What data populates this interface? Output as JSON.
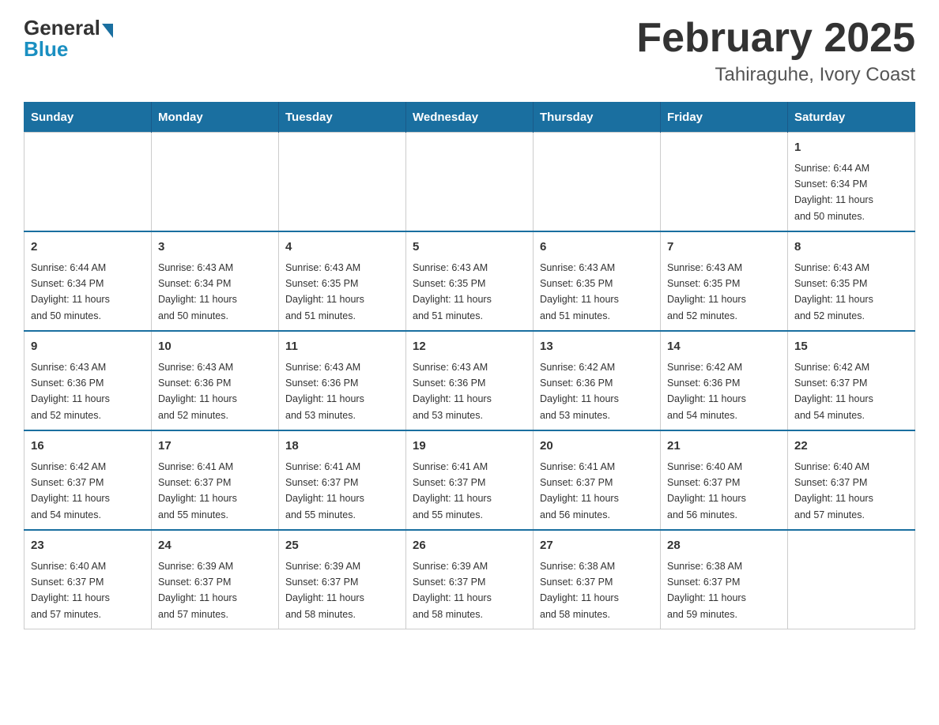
{
  "header": {
    "logo_general": "General",
    "logo_blue": "Blue",
    "title": "February 2025",
    "subtitle": "Tahiraguhe, Ivory Coast"
  },
  "days_of_week": [
    "Sunday",
    "Monday",
    "Tuesday",
    "Wednesday",
    "Thursday",
    "Friday",
    "Saturday"
  ],
  "weeks": [
    [
      {
        "day": "",
        "info": ""
      },
      {
        "day": "",
        "info": ""
      },
      {
        "day": "",
        "info": ""
      },
      {
        "day": "",
        "info": ""
      },
      {
        "day": "",
        "info": ""
      },
      {
        "day": "",
        "info": ""
      },
      {
        "day": "1",
        "info": "Sunrise: 6:44 AM\nSunset: 6:34 PM\nDaylight: 11 hours\nand 50 minutes."
      }
    ],
    [
      {
        "day": "2",
        "info": "Sunrise: 6:44 AM\nSunset: 6:34 PM\nDaylight: 11 hours\nand 50 minutes."
      },
      {
        "day": "3",
        "info": "Sunrise: 6:43 AM\nSunset: 6:34 PM\nDaylight: 11 hours\nand 50 minutes."
      },
      {
        "day": "4",
        "info": "Sunrise: 6:43 AM\nSunset: 6:35 PM\nDaylight: 11 hours\nand 51 minutes."
      },
      {
        "day": "5",
        "info": "Sunrise: 6:43 AM\nSunset: 6:35 PM\nDaylight: 11 hours\nand 51 minutes."
      },
      {
        "day": "6",
        "info": "Sunrise: 6:43 AM\nSunset: 6:35 PM\nDaylight: 11 hours\nand 51 minutes."
      },
      {
        "day": "7",
        "info": "Sunrise: 6:43 AM\nSunset: 6:35 PM\nDaylight: 11 hours\nand 52 minutes."
      },
      {
        "day": "8",
        "info": "Sunrise: 6:43 AM\nSunset: 6:35 PM\nDaylight: 11 hours\nand 52 minutes."
      }
    ],
    [
      {
        "day": "9",
        "info": "Sunrise: 6:43 AM\nSunset: 6:36 PM\nDaylight: 11 hours\nand 52 minutes."
      },
      {
        "day": "10",
        "info": "Sunrise: 6:43 AM\nSunset: 6:36 PM\nDaylight: 11 hours\nand 52 minutes."
      },
      {
        "day": "11",
        "info": "Sunrise: 6:43 AM\nSunset: 6:36 PM\nDaylight: 11 hours\nand 53 minutes."
      },
      {
        "day": "12",
        "info": "Sunrise: 6:43 AM\nSunset: 6:36 PM\nDaylight: 11 hours\nand 53 minutes."
      },
      {
        "day": "13",
        "info": "Sunrise: 6:42 AM\nSunset: 6:36 PM\nDaylight: 11 hours\nand 53 minutes."
      },
      {
        "day": "14",
        "info": "Sunrise: 6:42 AM\nSunset: 6:36 PM\nDaylight: 11 hours\nand 54 minutes."
      },
      {
        "day": "15",
        "info": "Sunrise: 6:42 AM\nSunset: 6:37 PM\nDaylight: 11 hours\nand 54 minutes."
      }
    ],
    [
      {
        "day": "16",
        "info": "Sunrise: 6:42 AM\nSunset: 6:37 PM\nDaylight: 11 hours\nand 54 minutes."
      },
      {
        "day": "17",
        "info": "Sunrise: 6:41 AM\nSunset: 6:37 PM\nDaylight: 11 hours\nand 55 minutes."
      },
      {
        "day": "18",
        "info": "Sunrise: 6:41 AM\nSunset: 6:37 PM\nDaylight: 11 hours\nand 55 minutes."
      },
      {
        "day": "19",
        "info": "Sunrise: 6:41 AM\nSunset: 6:37 PM\nDaylight: 11 hours\nand 55 minutes."
      },
      {
        "day": "20",
        "info": "Sunrise: 6:41 AM\nSunset: 6:37 PM\nDaylight: 11 hours\nand 56 minutes."
      },
      {
        "day": "21",
        "info": "Sunrise: 6:40 AM\nSunset: 6:37 PM\nDaylight: 11 hours\nand 56 minutes."
      },
      {
        "day": "22",
        "info": "Sunrise: 6:40 AM\nSunset: 6:37 PM\nDaylight: 11 hours\nand 57 minutes."
      }
    ],
    [
      {
        "day": "23",
        "info": "Sunrise: 6:40 AM\nSunset: 6:37 PM\nDaylight: 11 hours\nand 57 minutes."
      },
      {
        "day": "24",
        "info": "Sunrise: 6:39 AM\nSunset: 6:37 PM\nDaylight: 11 hours\nand 57 minutes."
      },
      {
        "day": "25",
        "info": "Sunrise: 6:39 AM\nSunset: 6:37 PM\nDaylight: 11 hours\nand 58 minutes."
      },
      {
        "day": "26",
        "info": "Sunrise: 6:39 AM\nSunset: 6:37 PM\nDaylight: 11 hours\nand 58 minutes."
      },
      {
        "day": "27",
        "info": "Sunrise: 6:38 AM\nSunset: 6:37 PM\nDaylight: 11 hours\nand 58 minutes."
      },
      {
        "day": "28",
        "info": "Sunrise: 6:38 AM\nSunset: 6:37 PM\nDaylight: 11 hours\nand 59 minutes."
      },
      {
        "day": "",
        "info": ""
      }
    ]
  ]
}
